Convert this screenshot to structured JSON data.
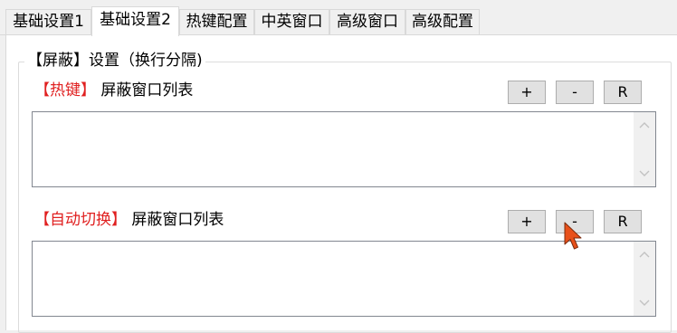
{
  "tabs": [
    {
      "label": "基础设置1",
      "active": false
    },
    {
      "label": "基础设置2",
      "active": true
    },
    {
      "label": "热键配置",
      "active": false
    },
    {
      "label": "中英窗口",
      "active": false
    },
    {
      "label": "高级窗口",
      "active": false
    },
    {
      "label": "高级配置",
      "active": false
    }
  ],
  "group": {
    "title": "【屏蔽】设置（换行分隔)"
  },
  "hotkey_section": {
    "tag": "【热键】",
    "label": "屏蔽窗口列表",
    "add_label": "+",
    "remove_label": "-",
    "reset_label": "R"
  },
  "auto_switch_section": {
    "tag": "【自动切换】",
    "label": "屏蔽窗口列表",
    "add_label": "+",
    "remove_label": "-",
    "reset_label": "R"
  },
  "colors": {
    "tag_red": "#e02020",
    "cursor_orange": "#e8501a"
  },
  "icons": {
    "scroll_up": "chevron-up-icon",
    "scroll_down": "chevron-down-icon",
    "cursor": "mouse-pointer-icon"
  }
}
